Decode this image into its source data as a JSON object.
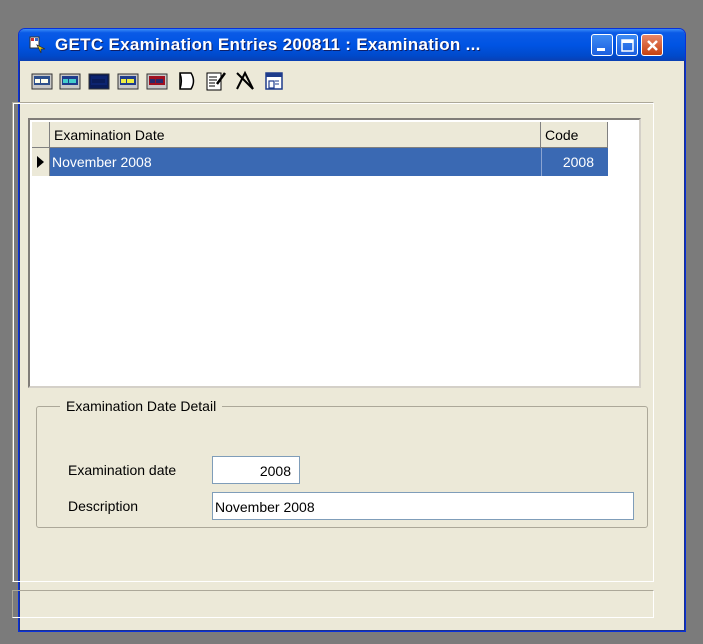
{
  "window": {
    "title": "GETC Examination Entries 200811 : Examination ..."
  },
  "toolbar": {
    "icons": [
      "first-record-icon",
      "previous-record-icon",
      "current-record-icon",
      "next-record-icon",
      "last-record-icon",
      "new-record-icon",
      "edit-record-icon",
      "delete-record-icon",
      "save-record-icon"
    ]
  },
  "grid": {
    "columns": [
      "Examination Date",
      "Code"
    ],
    "rows": [
      {
        "date": "November 2008",
        "code": "2008",
        "selected": true
      }
    ]
  },
  "detail": {
    "group_title": "Examination Date Detail",
    "exam_date_label": "Examination date",
    "exam_date_value": "2008",
    "description_label": "Description",
    "description_value": "November 2008"
  },
  "colors": {
    "titlebar": "#0054e3",
    "selection": "#3a69b3",
    "window_bg": "#ece9d8"
  }
}
